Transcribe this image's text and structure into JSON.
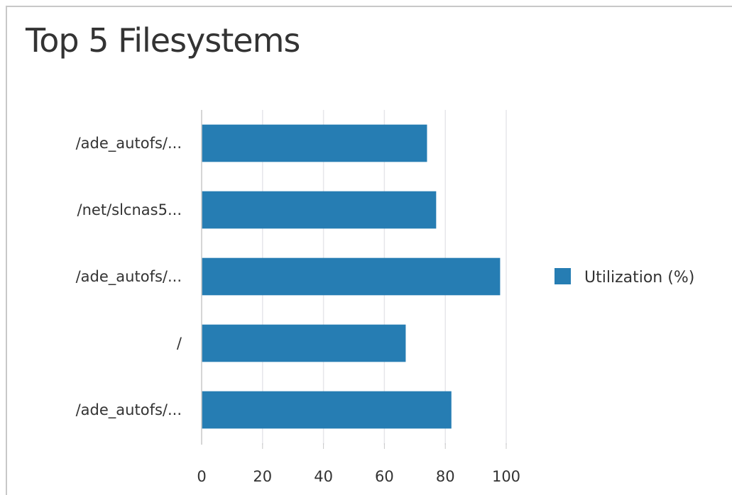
{
  "title": "Top 5 Filesystems",
  "chart_data": {
    "type": "bar",
    "orientation": "horizontal",
    "categories": [
      "/ade_autofs/...",
      "/net/slcnas5...",
      "/ade_autofs/...",
      "/",
      "/ade_autofs/..."
    ],
    "series": [
      {
        "name": "Utilization (%)",
        "values": [
          74,
          77,
          98,
          67,
          82
        ],
        "color": "#267db3"
      }
    ],
    "xlim": [
      0,
      100
    ],
    "xticks": [
      0,
      20,
      40,
      60,
      80,
      100
    ],
    "grid": true,
    "legend_position": "right"
  }
}
